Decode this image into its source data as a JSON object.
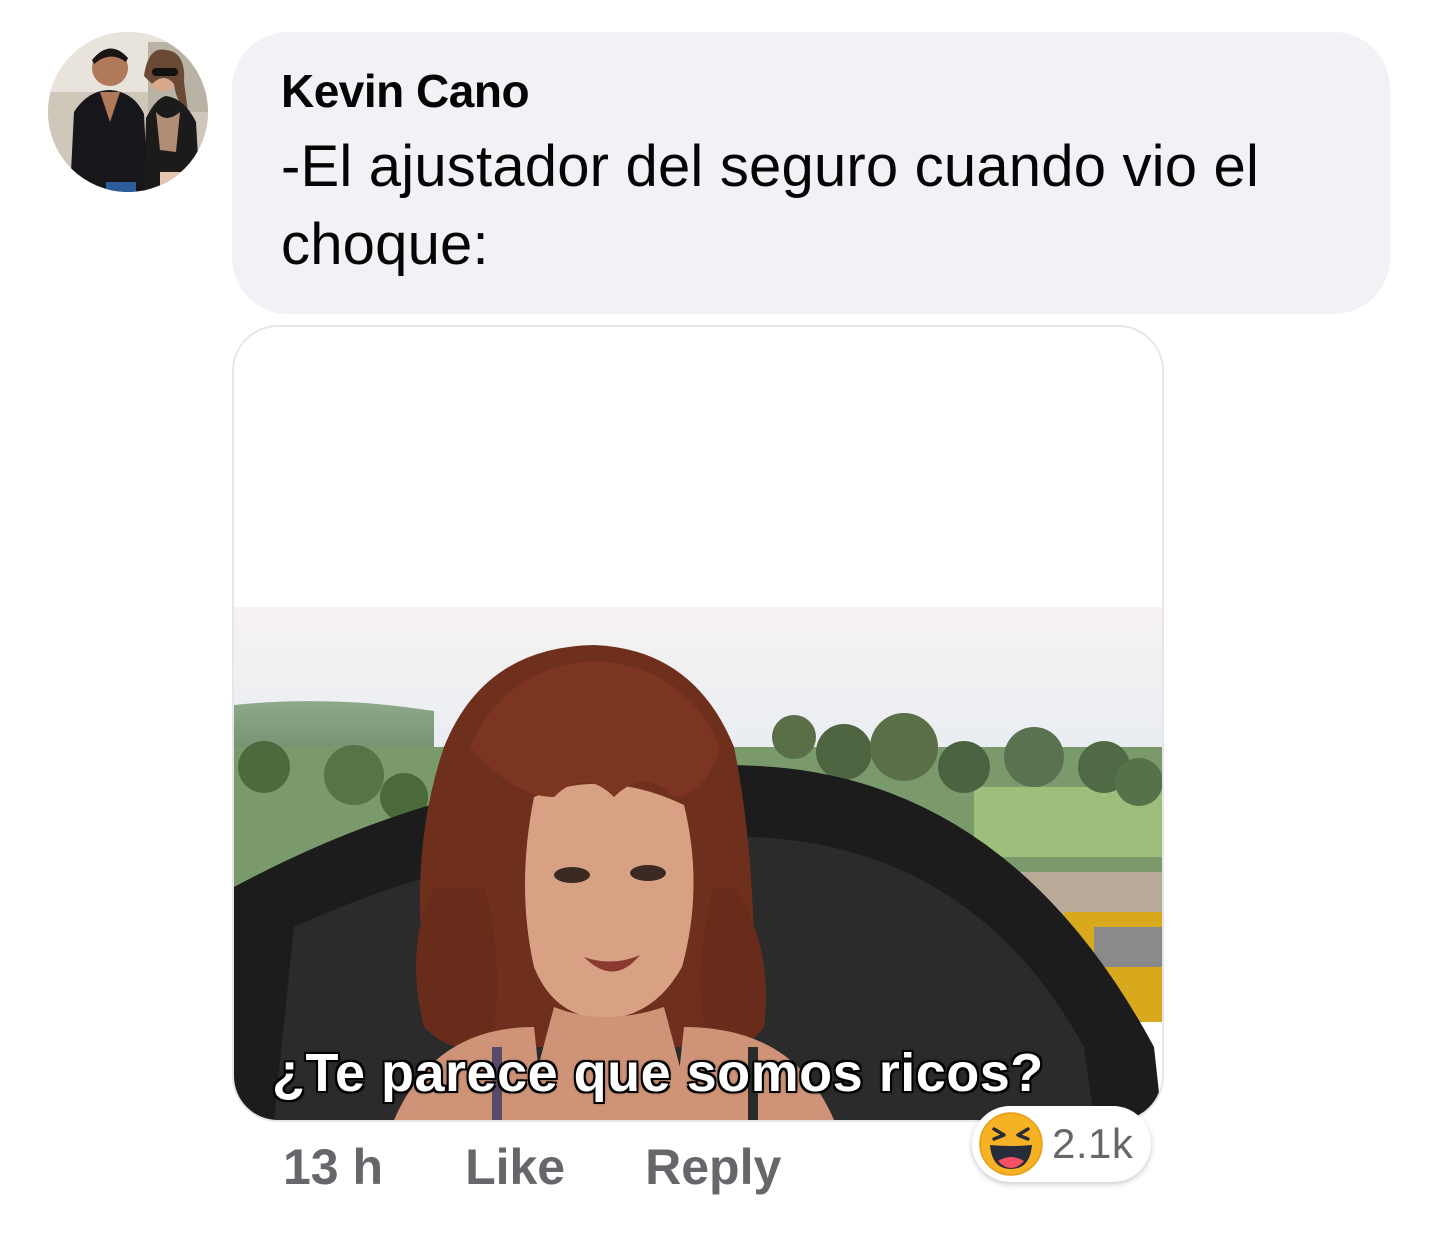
{
  "comment": {
    "author": "Kevin Cano",
    "text": "-El ajustador del seguro cuando vio el choque:",
    "attachment_caption": "¿Te parece que somos ricos?",
    "timestamp": "13 h",
    "like_label": "Like",
    "reply_label": "Reply",
    "reaction_icon": "haha-emoji-icon",
    "reaction_count": "2.1k"
  },
  "colors": {
    "bubble_bg": "#f0f2f5",
    "text_primary": "#050505",
    "text_secondary": "#65676b",
    "haha_yellow": "#f7b125"
  }
}
